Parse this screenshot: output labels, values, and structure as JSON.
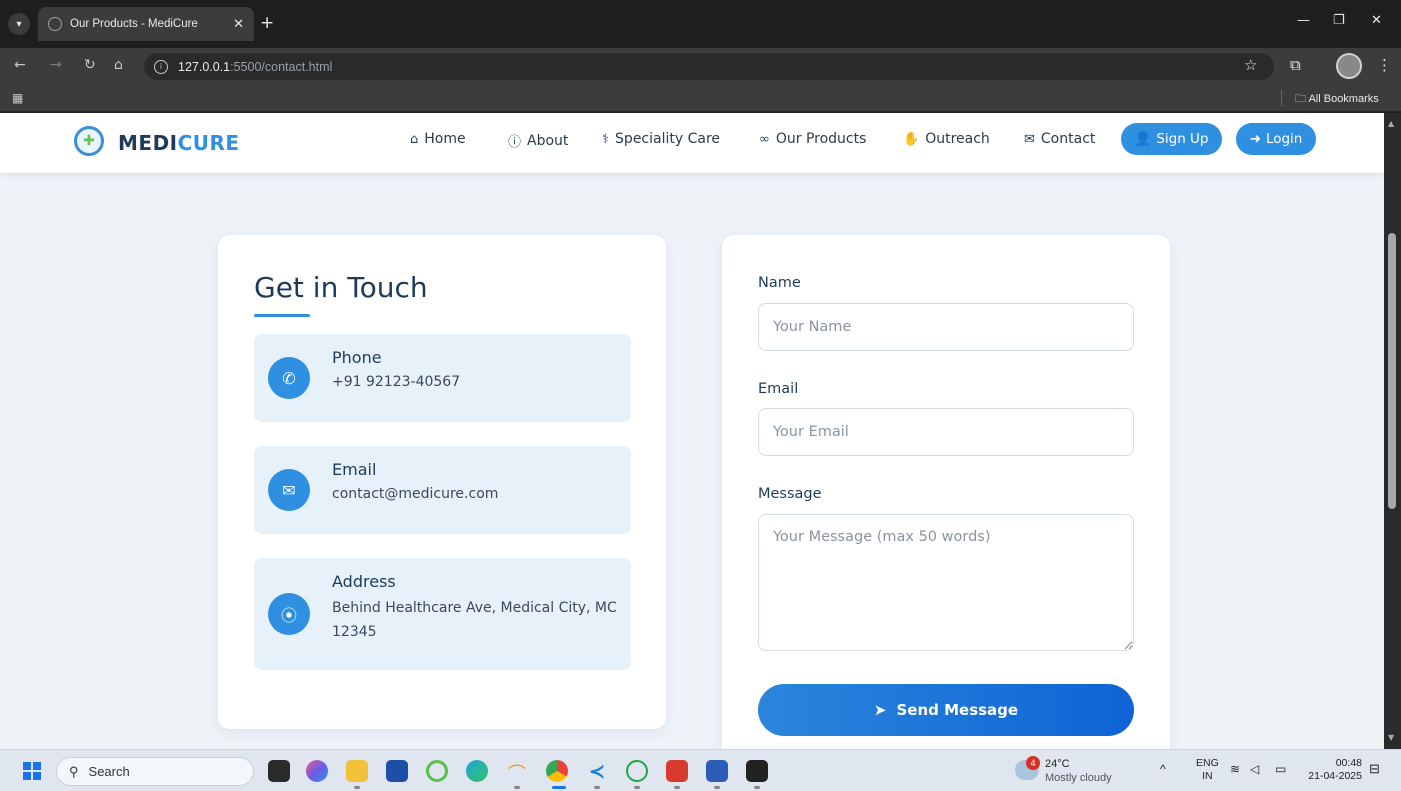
{
  "browser": {
    "tab_title": "Our Products - MediCure",
    "url_host": "127.0.0.1",
    "url_path": ":5500/contact.html",
    "bookmarks_label": "All Bookmarks"
  },
  "brand": {
    "part1": "MEDI",
    "part2": "CURE",
    "color_dark": "#1f3b5a",
    "color_accent": "#2f8fe0"
  },
  "nav": {
    "items": [
      {
        "label": "Home",
        "icon": "home-icon"
      },
      {
        "label": "About",
        "icon": "info-icon"
      },
      {
        "label": "Speciality Care",
        "icon": "stethoscope-icon"
      },
      {
        "label": "Our Products",
        "icon": "binoculars-icon"
      },
      {
        "label": "Outreach",
        "icon": "handshake-icon"
      },
      {
        "label": "Contact",
        "icon": "envelope-icon"
      }
    ],
    "signup_label": "Sign Up",
    "login_label": "Login"
  },
  "contact": {
    "title": "Get in Touch",
    "items": [
      {
        "label": "Phone",
        "value": "+91 92123-40567",
        "icon": "phone-icon"
      },
      {
        "label": "Email",
        "value": "contact@medicure.com",
        "icon": "envelope-icon"
      },
      {
        "label": "Address",
        "value": "Behind Healthcare Ave, Medical City, MC 12345",
        "icon": "location-pin-icon"
      }
    ]
  },
  "form": {
    "name_label": "Name",
    "name_placeholder": "Your Name",
    "email_label": "Email",
    "email_placeholder": "Your Email",
    "message_label": "Message",
    "message_placeholder": "Your Message (max 50 words)",
    "submit_label": "Send Message"
  },
  "taskbar": {
    "search_label": "Search",
    "weather_temp": "24°C",
    "weather_desc": "Mostly cloudy",
    "weather_badge": "4",
    "lang_line1": "ENG",
    "lang_line2": "IN",
    "time": "00:48",
    "date": "21-04-2025"
  }
}
